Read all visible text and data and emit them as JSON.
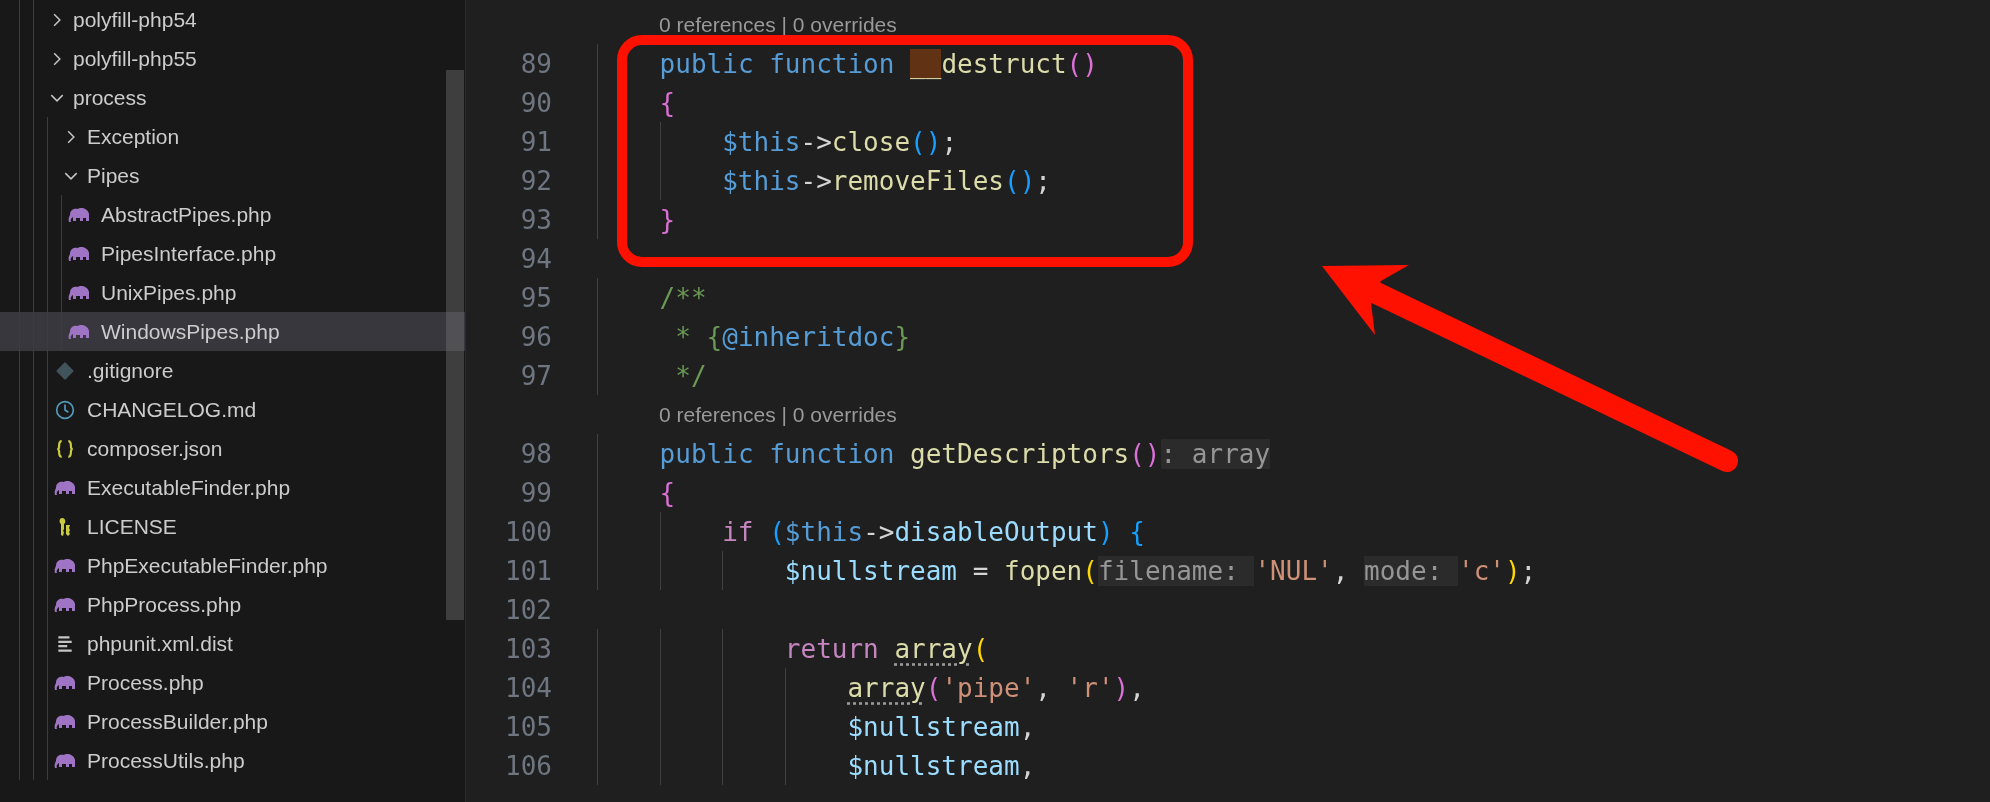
{
  "explorer": {
    "tree": [
      {
        "label": "polyfill-php54",
        "kind": "folder",
        "expanded": false,
        "selected": false
      },
      {
        "label": "polyfill-php55",
        "kind": "folder",
        "expanded": false,
        "selected": false
      },
      {
        "label": "process",
        "kind": "folder",
        "expanded": true,
        "selected": false,
        "children": [
          {
            "label": "Exception",
            "kind": "folder",
            "expanded": false,
            "selected": false
          },
          {
            "label": "Pipes",
            "kind": "folder",
            "expanded": true,
            "selected": false,
            "children": [
              {
                "label": "AbstractPipes.php",
                "kind": "php",
                "selected": false
              },
              {
                "label": "PipesInterface.php",
                "kind": "php",
                "selected": false
              },
              {
                "label": "UnixPipes.php",
                "kind": "php",
                "selected": false
              },
              {
                "label": "WindowsPipes.php",
                "kind": "php",
                "selected": true
              }
            ]
          },
          {
            "label": ".gitignore",
            "kind": "git",
            "selected": false
          },
          {
            "label": "CHANGELOG.md",
            "kind": "changelog",
            "selected": false
          },
          {
            "label": "composer.json",
            "kind": "json",
            "selected": false
          },
          {
            "label": "ExecutableFinder.php",
            "kind": "php",
            "selected": false
          },
          {
            "label": "LICENSE",
            "kind": "license",
            "selected": false
          },
          {
            "label": "PhpExecutableFinder.php",
            "kind": "php",
            "selected": false
          },
          {
            "label": "PhpProcess.php",
            "kind": "php",
            "selected": false
          },
          {
            "label": "phpunit.xml.dist",
            "kind": "text",
            "selected": false
          },
          {
            "label": "Process.php",
            "kind": "php",
            "selected": false
          },
          {
            "label": "ProcessBuilder.php",
            "kind": "php",
            "selected": false
          },
          {
            "label": "ProcessUtils.php",
            "kind": "php",
            "selected": false
          }
        ]
      }
    ]
  },
  "editor": {
    "lines": [
      {
        "kind": "codelens",
        "text": "0 references | 0 overrides"
      },
      {
        "kind": "code",
        "number": "89",
        "tokens": [
          {
            "text": "    public function ",
            "kind": "keyword"
          },
          {
            "text": "__",
            "kind": "match"
          },
          {
            "text": "destruct",
            "kind": "function"
          },
          {
            "text": "()",
            "kind": "brace2"
          }
        ]
      },
      {
        "kind": "code",
        "number": "90",
        "tokens": [
          {
            "text": "    {",
            "kind": "brace2"
          }
        ]
      },
      {
        "kind": "code",
        "number": "91",
        "tokens": [
          {
            "text": "        $this",
            "kind": "keyword"
          },
          {
            "text": "->",
            "kind": "punct"
          },
          {
            "text": "close",
            "kind": "function"
          },
          {
            "text": "()",
            "kind": "brace3"
          },
          {
            "text": ";",
            "kind": "punct"
          }
        ]
      },
      {
        "kind": "code",
        "number": "92",
        "tokens": [
          {
            "text": "        $this",
            "kind": "keyword"
          },
          {
            "text": "->",
            "kind": "punct"
          },
          {
            "text": "removeFiles",
            "kind": "function"
          },
          {
            "text": "()",
            "kind": "brace3"
          },
          {
            "text": ";",
            "kind": "punct"
          }
        ]
      },
      {
        "kind": "code",
        "number": "93",
        "tokens": [
          {
            "text": "    }",
            "kind": "brace2"
          }
        ]
      },
      {
        "kind": "code",
        "number": "94"
      },
      {
        "kind": "code",
        "number": "95",
        "tokens": [
          {
            "text": "    /**",
            "kind": "comment"
          }
        ]
      },
      {
        "kind": "code",
        "number": "96",
        "tokens": [
          {
            "text": "     * {",
            "kind": "comment"
          },
          {
            "text": "@inheritdoc",
            "kind": "keyword"
          },
          {
            "text": "}",
            "kind": "comment"
          }
        ]
      },
      {
        "kind": "code",
        "number": "97",
        "tokens": [
          {
            "text": "     */",
            "kind": "comment"
          }
        ]
      },
      {
        "kind": "codelens",
        "text": "0 references | 0 overrides"
      },
      {
        "kind": "code",
        "number": "98",
        "tokens": [
          {
            "text": "    public function ",
            "kind": "keyword"
          },
          {
            "text": "getDescriptors",
            "kind": "function"
          },
          {
            "text": "()",
            "kind": "brace2"
          },
          {
            "text": ": array",
            "kind": "hint"
          }
        ]
      },
      {
        "kind": "code",
        "number": "99",
        "tokens": [
          {
            "text": "    {",
            "kind": "brace2"
          }
        ]
      },
      {
        "kind": "code",
        "number": "100",
        "tokens": [
          {
            "text": "        if ",
            "kind": "control"
          },
          {
            "text": "(",
            "kind": "brace3"
          },
          {
            "text": "$this",
            "kind": "keyword"
          },
          {
            "text": "->",
            "kind": "punct"
          },
          {
            "text": "disableOutput",
            "kind": "variable"
          },
          {
            "text": ") ",
            "kind": "brace3"
          },
          {
            "text": "{",
            "kind": "brace3"
          }
        ]
      },
      {
        "kind": "code",
        "number": "101",
        "tokens": [
          {
            "text": "            $nullstream",
            "kind": "variable"
          },
          {
            "text": " = ",
            "kind": "punct"
          },
          {
            "text": "fopen",
            "kind": "function"
          },
          {
            "text": "(",
            "kind": "brace1"
          },
          {
            "text": "filename: ",
            "kind": "hint"
          },
          {
            "text": "'NUL'",
            "kind": "string"
          },
          {
            "text": ", ",
            "kind": "punct"
          },
          {
            "text": "mode: ",
            "kind": "hint"
          },
          {
            "text": "'c'",
            "kind": "string"
          },
          {
            "text": ")",
            "kind": "brace1"
          },
          {
            "text": ";",
            "kind": "punct"
          }
        ]
      },
      {
        "kind": "code",
        "number": "102"
      },
      {
        "kind": "code",
        "number": "103",
        "tokens": [
          {
            "text": "            return ",
            "kind": "control"
          },
          {
            "text": "array",
            "kind": "function-hinted"
          },
          {
            "text": "(",
            "kind": "brace1"
          }
        ]
      },
      {
        "kind": "code",
        "number": "104",
        "tokens": [
          {
            "text": "                array",
            "kind": "function-hinted"
          },
          {
            "text": "(",
            "kind": "brace2"
          },
          {
            "text": "'pipe'",
            "kind": "string"
          },
          {
            "text": ", ",
            "kind": "punct"
          },
          {
            "text": "'r'",
            "kind": "string"
          },
          {
            "text": ")",
            "kind": "brace2"
          },
          {
            "text": ",",
            "kind": "punct"
          }
        ]
      },
      {
        "kind": "code",
        "number": "105",
        "tokens": [
          {
            "text": "                $nullstream",
            "kind": "variable"
          },
          {
            "text": ",",
            "kind": "punct"
          }
        ]
      },
      {
        "kind": "code",
        "number": "106",
        "tokens": [
          {
            "text": "                $nullstream",
            "kind": "variable"
          },
          {
            "text": ",",
            "kind": "punct"
          }
        ]
      }
    ]
  }
}
